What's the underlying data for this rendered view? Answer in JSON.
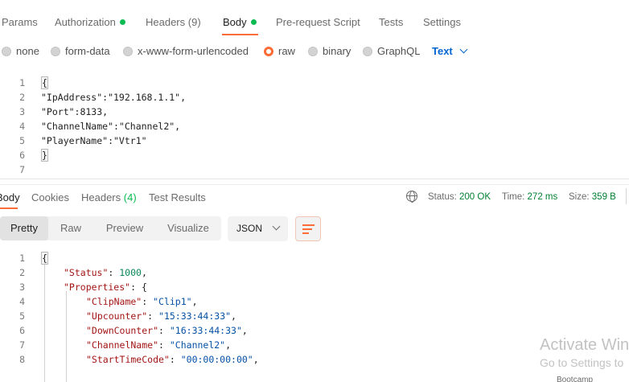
{
  "request_tabs": [
    {
      "label": "Params"
    },
    {
      "label": "Authorization"
    },
    {
      "label": "Headers",
      "count": "(9)"
    },
    {
      "label": "Body"
    },
    {
      "label": "Pre-request Script"
    },
    {
      "label": "Tests"
    },
    {
      "label": "Settings"
    }
  ],
  "body_types": [
    "none",
    "form-data",
    "x-www-form-urlencoded",
    "raw",
    "binary",
    "GraphQL"
  ],
  "body_type_selected": "raw",
  "body_language": "Text",
  "request_body": {
    "line_numbers": [
      "1",
      "2",
      "3",
      "4",
      "5",
      "6",
      "7"
    ],
    "lines": [
      "{",
      "\"IpAddress\":\"192.168.1.1\",",
      "\"Port\":8133,",
      "\"ChannelName\":\"Channel2\",",
      "\"PlayerName\":\"Vtr1\"",
      "}",
      ""
    ]
  },
  "response_tabs": [
    {
      "label": "Body"
    },
    {
      "label": "Cookies"
    },
    {
      "label": "Headers",
      "count": "(4)"
    },
    {
      "label": "Test Results"
    }
  ],
  "response_meta": {
    "status_label": "Status:",
    "status_value": "200 OK",
    "time_label": "Time:",
    "time_value": "272 ms",
    "size_label": "Size:",
    "size_value": "359 B"
  },
  "view_modes": [
    "Pretty",
    "Raw",
    "Preview",
    "Visualize"
  ],
  "view_mode_selected": "Pretty",
  "response_format": "JSON",
  "response_body": {
    "line_numbers": [
      "1",
      "2",
      "3",
      "4",
      "5",
      "6",
      "7",
      "8"
    ],
    "open_brace": "{",
    "status_key": "\"Status\"",
    "status_value": "1000",
    "properties_key": "\"Properties\"",
    "properties_open": "{",
    "clipname_key": "\"ClipName\"",
    "clipname_value": "\"Clip1\"",
    "upcounter_key": "\"Upcounter\"",
    "upcounter_value": "\"15:33:44:33\"",
    "downcounter_key": "\"DownCounter\"",
    "downcounter_value": "\"16:33:44:33\"",
    "channelname_key": "\"ChannelName\"",
    "channelname_value": "\"Channel2\"",
    "starttimecode_key": "\"StartTimeCode\"",
    "starttimecode_value": "\"00:00:00:00\""
  },
  "watermark": {
    "line1": "Activate Win",
    "line2": "Go to Settings to"
  },
  "bottom_fragment": "Bootcamp",
  "colors": {
    "accent": "#ff6c37",
    "link": "#0265d2",
    "success": "#0cbb52"
  }
}
